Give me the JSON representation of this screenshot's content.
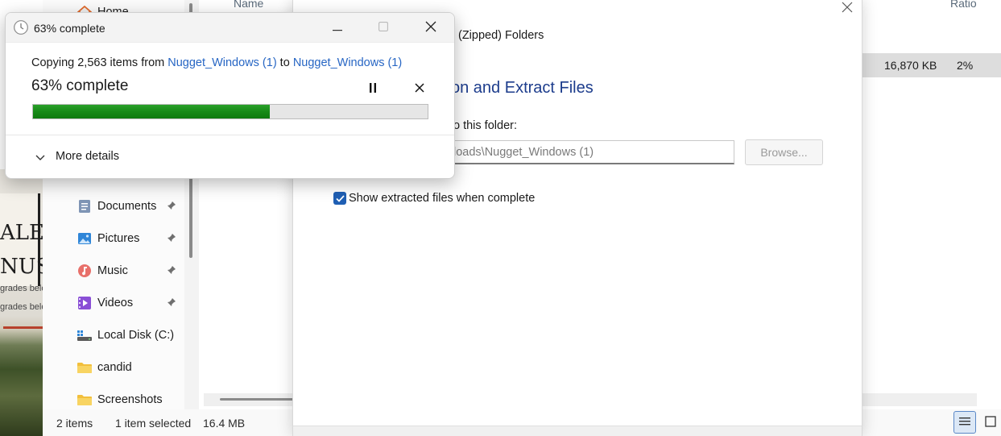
{
  "photo": {
    "sign_lines": [
      "ALE",
      "NUS"
    ],
    "small_lines": [
      "grades belo",
      "grades belo"
    ]
  },
  "explorer": {
    "nav_items": [
      {
        "label": "Home",
        "icon": "home-icon",
        "pinned": false
      },
      {
        "label": "Documents",
        "icon": "documents-icon",
        "pinned": true
      },
      {
        "label": "Pictures",
        "icon": "pictures-icon",
        "pinned": true
      },
      {
        "label": "Music",
        "icon": "music-icon",
        "pinned": true
      },
      {
        "label": "Videos",
        "icon": "videos-icon",
        "pinned": true
      },
      {
        "label": "Local Disk (C:)",
        "icon": "drive-icon",
        "pinned": false
      },
      {
        "label": "candid",
        "icon": "folder-icon",
        "pinned": false
      },
      {
        "label": "Screenshots",
        "icon": "folder-icon",
        "pinned": false
      }
    ],
    "columns": {
      "name": "Name",
      "ratio": "Ratio"
    },
    "selected_row": {
      "size": "16,870 KB",
      "ratio": "2%"
    },
    "status": {
      "item_count": "2 items",
      "selection": "1 item selected",
      "size": "16.4 MB"
    },
    "view_buttons": [
      "details-view-icon",
      "tiles-view-icon"
    ]
  },
  "wizard": {
    "title_fragment": "(Zipped) Folders",
    "heading": "on and Extract Files",
    "folder_label": "o this folder:",
    "path_value": "loads\\Nugget_Windows (1)",
    "browse_label": "Browse...",
    "show_files_label": "Show extracted files when complete",
    "show_files_checked": true
  },
  "copy_dialog": {
    "title": "63% complete",
    "line_prefix": "Copying 2,563 items from ",
    "source": "Nugget_Windows (1)",
    "line_middle": " to ",
    "destination": "Nugget_Windows (1)",
    "percent_label": "63% complete",
    "progress": 0.6,
    "progress_color": "#178a17",
    "more_details": "More details"
  }
}
